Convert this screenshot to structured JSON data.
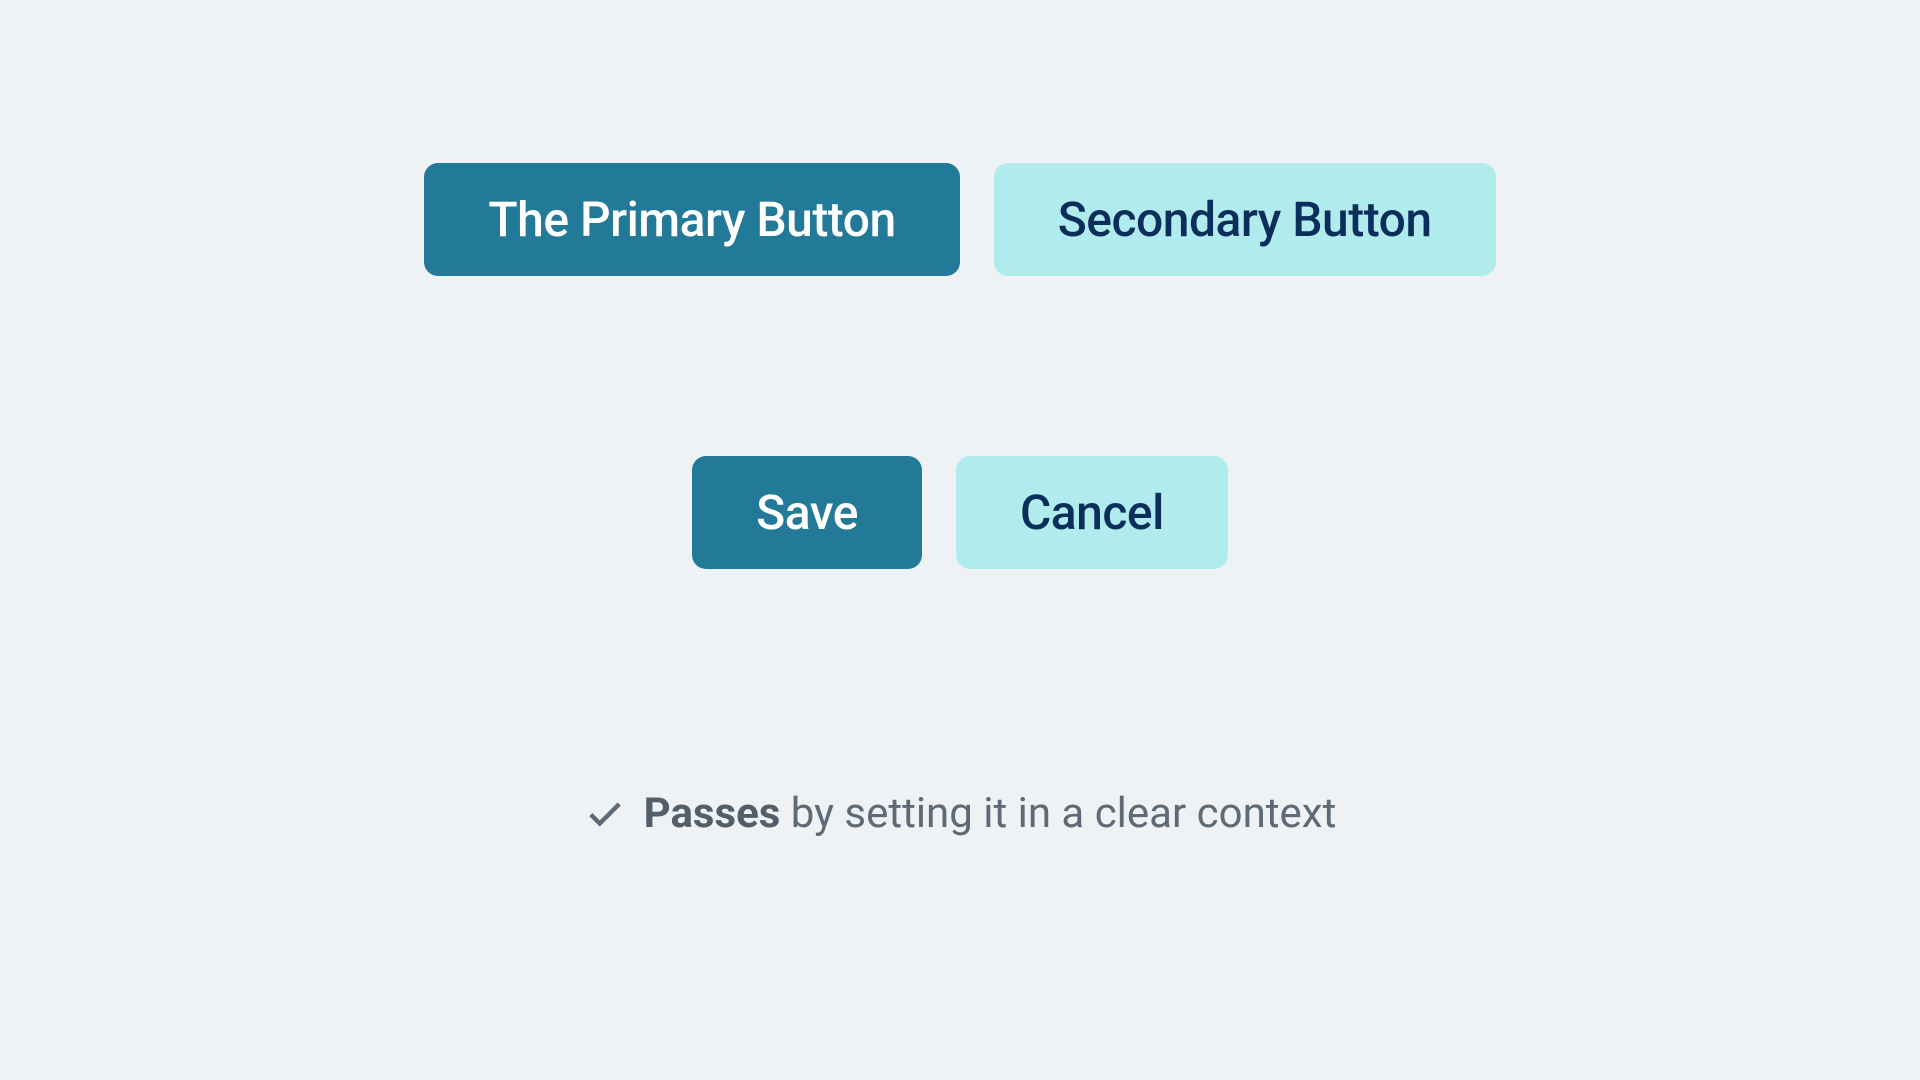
{
  "row1": {
    "primary_label": "The Primary Button",
    "secondary_label": "Secondary Button"
  },
  "row2": {
    "primary_label": "Save",
    "secondary_label": "Cancel"
  },
  "caption": {
    "strong": "Passes",
    "rest": " by setting it in a clear context"
  },
  "colors": {
    "primary_bg": "#237a98",
    "primary_fg": "#ffffff",
    "secondary_bg": "#b0ebed",
    "secondary_fg": "#0c2e5a",
    "page_bg": "#eef2f5",
    "caption": "#5e6b76"
  }
}
